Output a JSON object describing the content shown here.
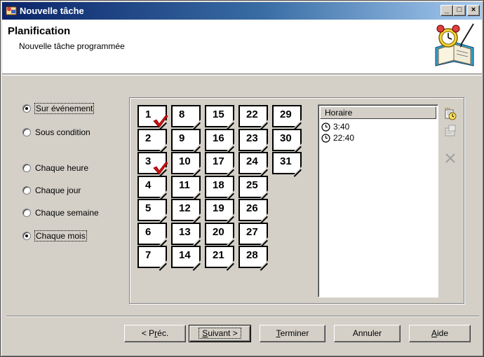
{
  "window": {
    "title": "Nouvelle tâche",
    "controls": {
      "minimize": "_",
      "maximize": "□",
      "close": "×"
    }
  },
  "header": {
    "title": "Planification",
    "subtitle": "Nouvelle tâche programmée",
    "logo_icon": "alarm-clock-agenda-icon"
  },
  "schedule_options": [
    {
      "label": "Sur événement",
      "checked": true,
      "focused": true
    },
    {
      "label": "Sous condition",
      "checked": false,
      "focused": false
    },
    {
      "label": "Chaque heure",
      "checked": false,
      "focused": false
    },
    {
      "label": "Chaque jour",
      "checked": false,
      "focused": false
    },
    {
      "label": "Chaque semaine",
      "checked": false,
      "focused": false
    },
    {
      "label": "Chaque mois",
      "checked": true,
      "focused": true
    }
  ],
  "days": [
    {
      "n": "1",
      "checked": true
    },
    {
      "n": "2",
      "checked": false
    },
    {
      "n": "3",
      "checked": true
    },
    {
      "n": "4",
      "checked": false
    },
    {
      "n": "5",
      "checked": false
    },
    {
      "n": "6",
      "checked": false
    },
    {
      "n": "7",
      "checked": false
    },
    {
      "n": "8",
      "checked": false
    },
    {
      "n": "9",
      "checked": false
    },
    {
      "n": "10",
      "checked": false
    },
    {
      "n": "11",
      "checked": false
    },
    {
      "n": "12",
      "checked": false
    },
    {
      "n": "13",
      "checked": false
    },
    {
      "n": "14",
      "checked": false
    },
    {
      "n": "15",
      "checked": false
    },
    {
      "n": "16",
      "checked": false
    },
    {
      "n": "17",
      "checked": false
    },
    {
      "n": "18",
      "checked": false
    },
    {
      "n": "19",
      "checked": false
    },
    {
      "n": "20",
      "checked": false
    },
    {
      "n": "21",
      "checked": false
    },
    {
      "n": "22",
      "checked": false
    },
    {
      "n": "23",
      "checked": false
    },
    {
      "n": "24",
      "checked": false
    },
    {
      "n": "25",
      "checked": false
    },
    {
      "n": "26",
      "checked": false
    },
    {
      "n": "27",
      "checked": false
    },
    {
      "n": "28",
      "checked": false
    },
    {
      "n": "29",
      "checked": false
    },
    {
      "n": "30",
      "checked": false
    },
    {
      "n": "31",
      "checked": false
    }
  ],
  "times_list": {
    "header": "Horaire",
    "items": [
      "3:40",
      "22:40"
    ],
    "item_icon": "clock-icon"
  },
  "side_tools": [
    {
      "name": "add-time-icon",
      "enabled": true
    },
    {
      "name": "edit-properties-icon",
      "enabled": false
    },
    {
      "name": "delete-icon",
      "enabled": false
    }
  ],
  "buttons": {
    "prev": {
      "before": "< P",
      "accel": "r",
      "after": "éc."
    },
    "next": {
      "before": "",
      "accel": "S",
      "after": "uivant >"
    },
    "finish": {
      "before": "",
      "accel": "T",
      "after": "erminer"
    },
    "cancel": {
      "before": "Annuler",
      "accel": "",
      "after": ""
    },
    "help": {
      "before": "",
      "accel": "A",
      "after": "ide"
    }
  }
}
